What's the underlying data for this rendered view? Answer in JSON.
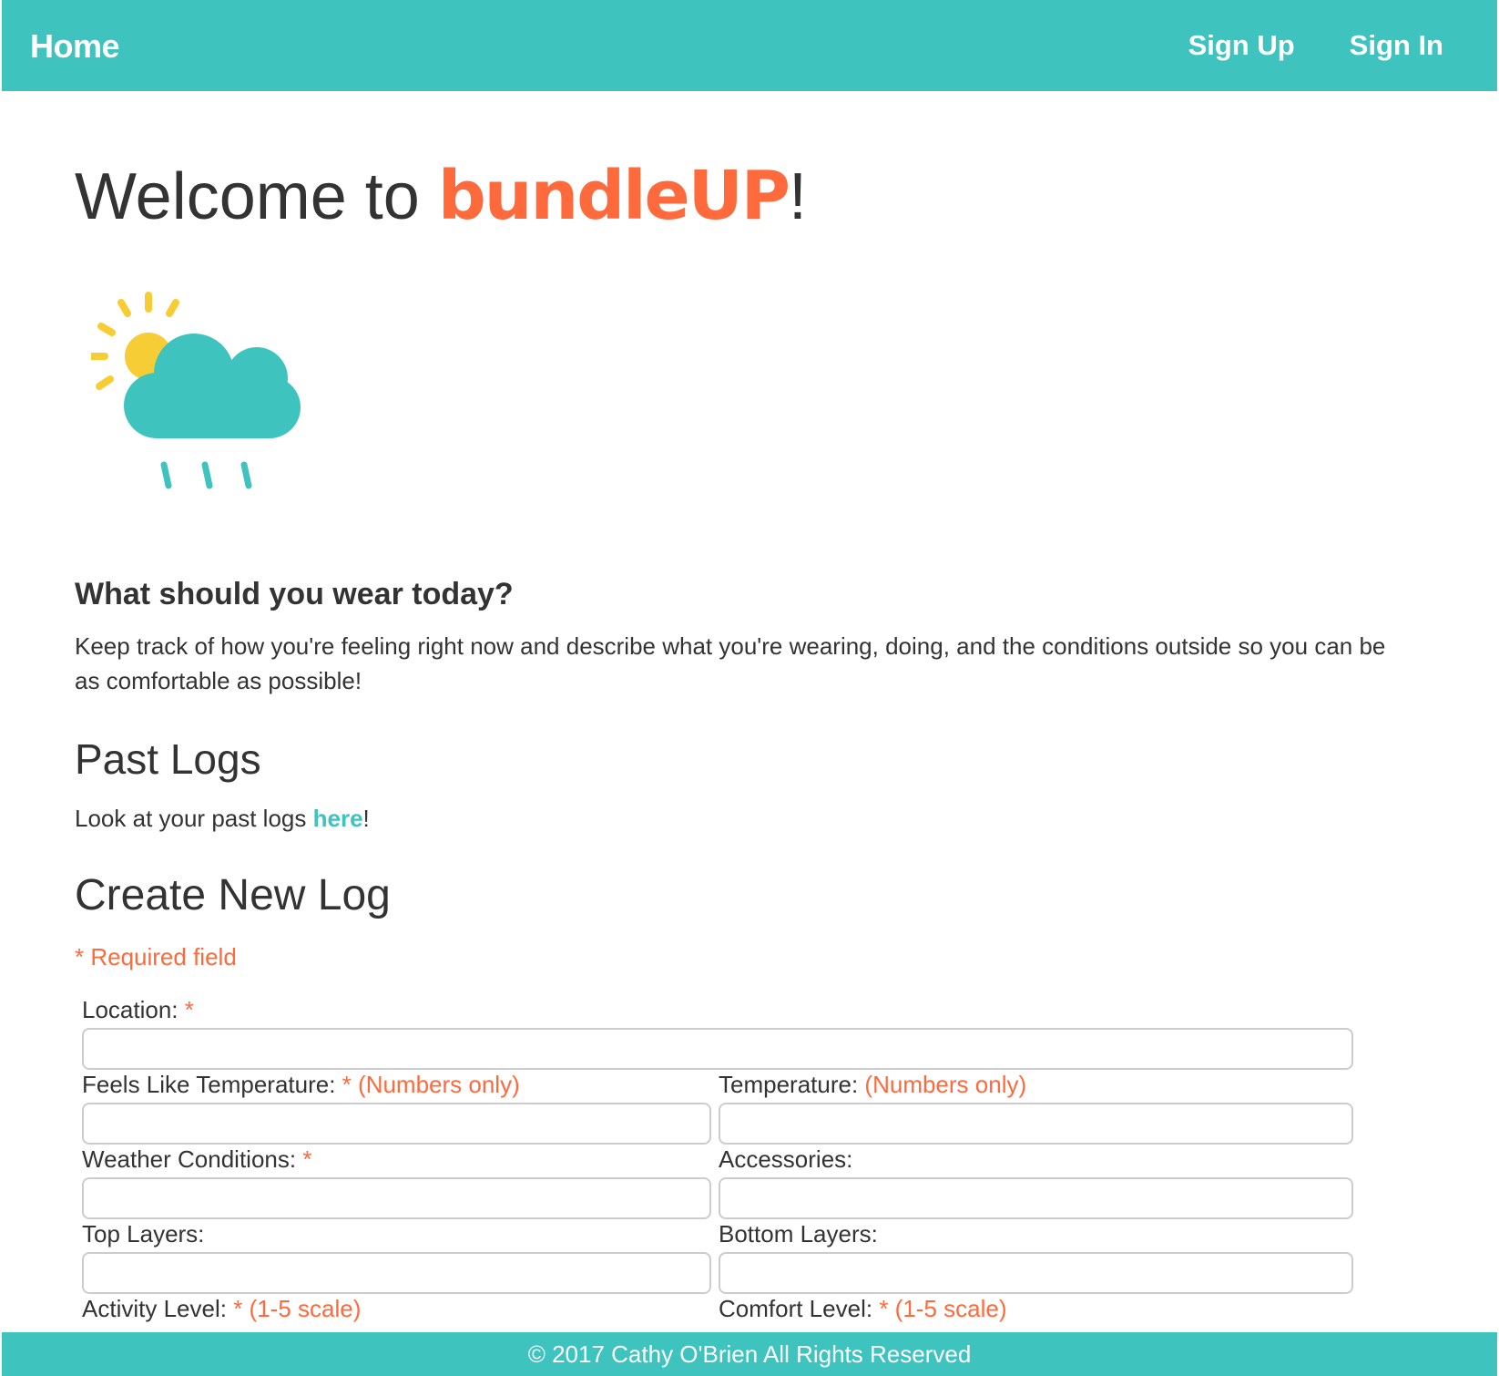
{
  "nav": {
    "home": "Home",
    "sign_up": "Sign Up",
    "sign_in": "Sign In"
  },
  "hero": {
    "welcome_prefix": "Welcome to ",
    "brand": "bundleUP",
    "welcome_suffix": "!"
  },
  "intro": {
    "heading": "What should you wear today?",
    "text": "Keep track of how you're feeling right now and describe what you're wearing, doing, and the conditions outside so you can be as comfortable as possible!"
  },
  "past_logs": {
    "title": "Past Logs",
    "text_prefix": "Look at your past logs ",
    "link": "here",
    "text_suffix": "!"
  },
  "create_log": {
    "title": "Create New Log",
    "required_note": "* Required field"
  },
  "form": {
    "location_label": "Location:",
    "feels_like_label": "Feels Like Temperature:",
    "temperature_label": "Temperature:",
    "weather_label": "Weather Conditions:",
    "accessories_label": "Accessories:",
    "top_layers_label": "Top Layers:",
    "bottom_layers_label": "Bottom Layers:",
    "activity_label": "Activity Level:",
    "comfort_label": "Comfort Level:",
    "required_mark": "*",
    "numbers_only": "(Numbers only)",
    "scale_hint": "(1-5 scale)",
    "location_value": "",
    "feels_like_value": "",
    "temperature_value": "",
    "weather_value": "",
    "accessories_value": "",
    "top_layers_value": "",
    "bottom_layers_value": ""
  },
  "footer": {
    "text": "© 2017 Cathy O'Brien All Rights Reserved"
  },
  "colors": {
    "teal": "#3fc3bf",
    "orange": "#ff6a3d",
    "sun": "#f7cd35"
  },
  "icons": {
    "weather": "partly-sunny-rain-icon"
  }
}
